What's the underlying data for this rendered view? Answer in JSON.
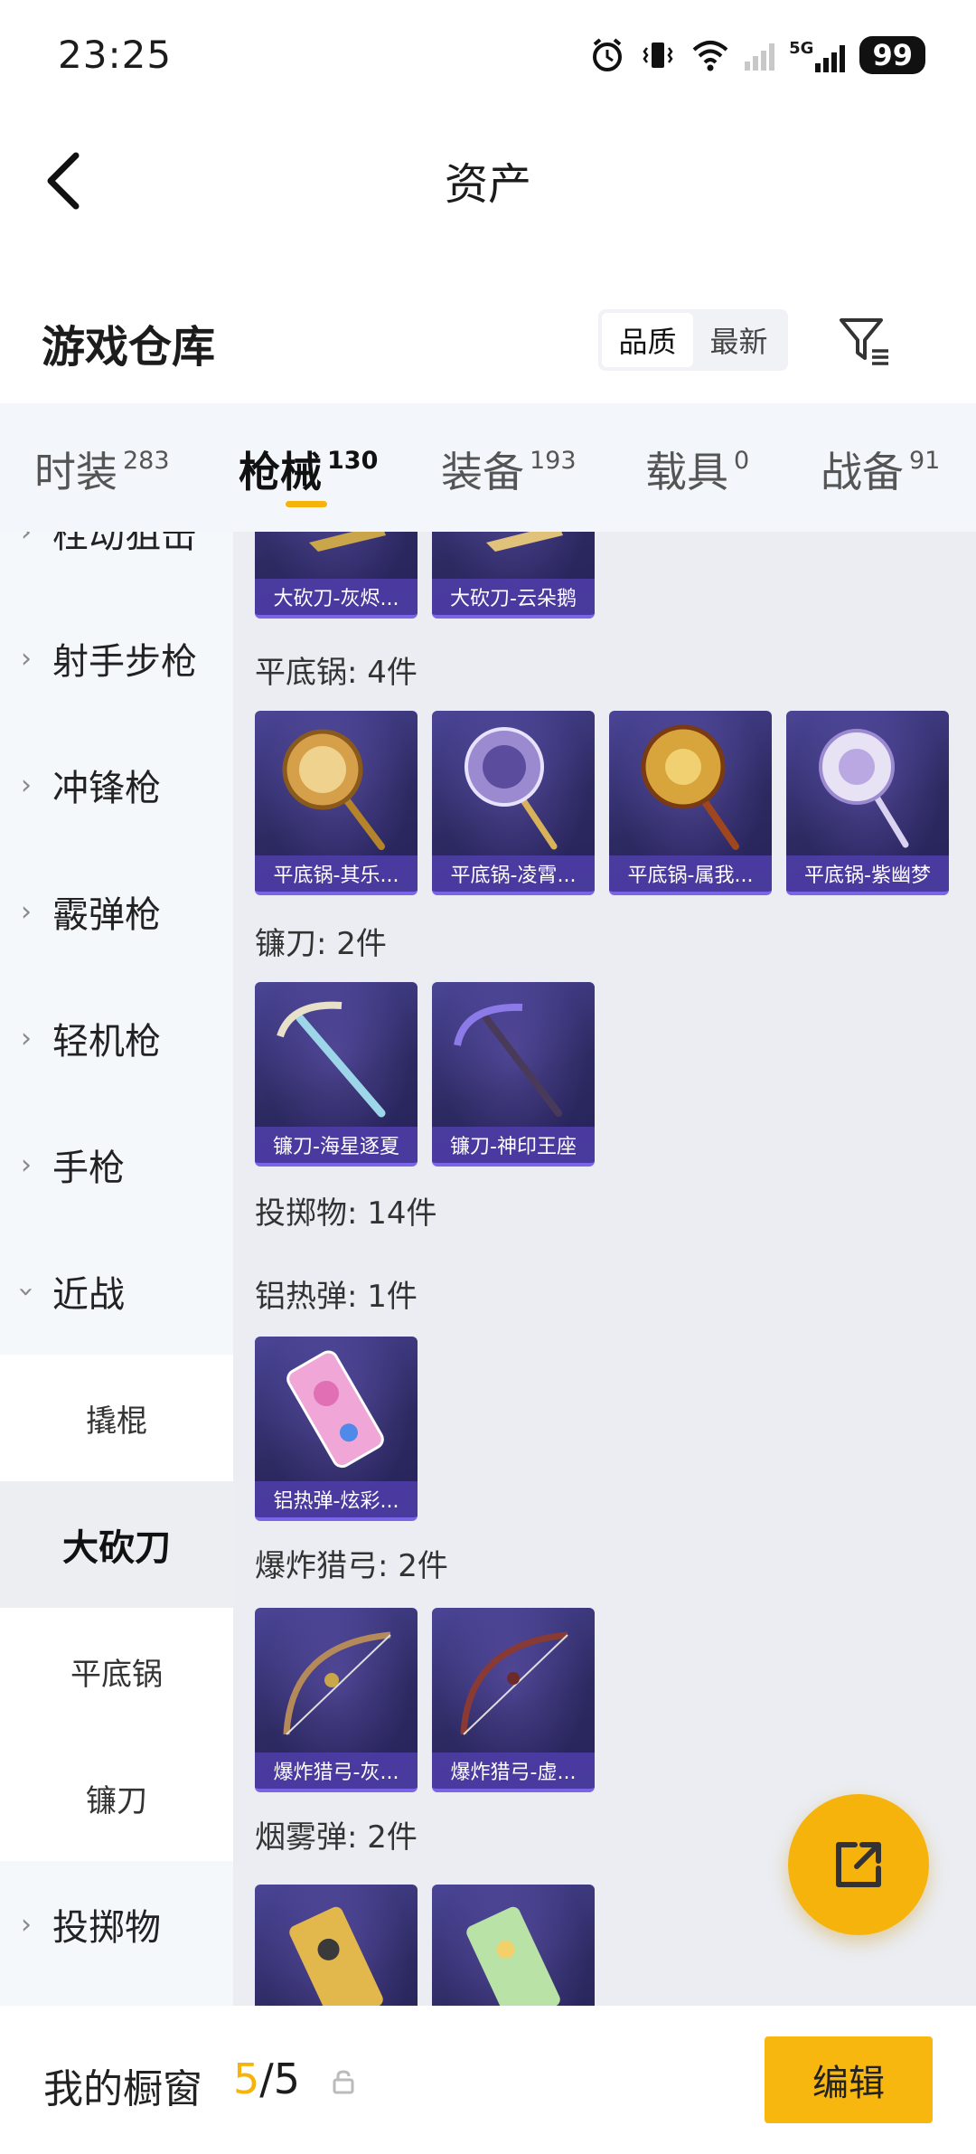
{
  "status": {
    "time": "23:25",
    "battery": "99",
    "net_label": "5G"
  },
  "nav": {
    "title": "资产"
  },
  "section": {
    "title": "游戏仓库",
    "sort_options": [
      "品质",
      "最新"
    ],
    "sort_active": "品质"
  },
  "tabs": [
    {
      "label": "时装",
      "count": "283"
    },
    {
      "label": "枪械",
      "count": "130"
    },
    {
      "label": "装备",
      "count": "193"
    },
    {
      "label": "载具",
      "count": "0"
    },
    {
      "label": "战备",
      "count": "91"
    }
  ],
  "sidebar": {
    "items": [
      "栓动狙击",
      "射手步枪",
      "冲锋枪",
      "霰弹枪",
      "轻机枪",
      "手枪",
      "近战"
    ],
    "sub_items": [
      "撬棍",
      "大砍刀",
      "平底锅",
      "镰刀"
    ],
    "after": "投掷物"
  },
  "content": {
    "top_cards": [
      "大砍刀-灰烬...",
      "大砍刀-云朵鹅"
    ],
    "groups": [
      {
        "title": "平底锅: 4件",
        "cards": [
          "平底锅-其乐...",
          "平底锅-凌霄...",
          "平底锅-属我...",
          "平底锅-紫幽梦"
        ]
      },
      {
        "title": "镰刀: 2件",
        "cards": [
          "镰刀-海星逐夏",
          "镰刀-神印王座"
        ]
      },
      {
        "title": "投掷物: 14件",
        "cards": []
      },
      {
        "title": "铝热弹: 1件",
        "cards": [
          "铝热弹-炫彩..."
        ]
      },
      {
        "title": "爆炸猎弓: 2件",
        "cards": [
          "爆炸猎弓-灰...",
          "爆炸猎弓-虚..."
        ]
      },
      {
        "title": "烟雾弹: 2件",
        "cards": [
          "",
          ""
        ]
      }
    ]
  },
  "bottom": {
    "label": "我的橱窗",
    "count_current": "5",
    "count_sep": "/",
    "count_total": "5",
    "edit_label": "编辑"
  },
  "colors": {
    "accent": "#f6b30c",
    "card_bg": "#2d2a62",
    "label_bg": "#503eaa"
  }
}
